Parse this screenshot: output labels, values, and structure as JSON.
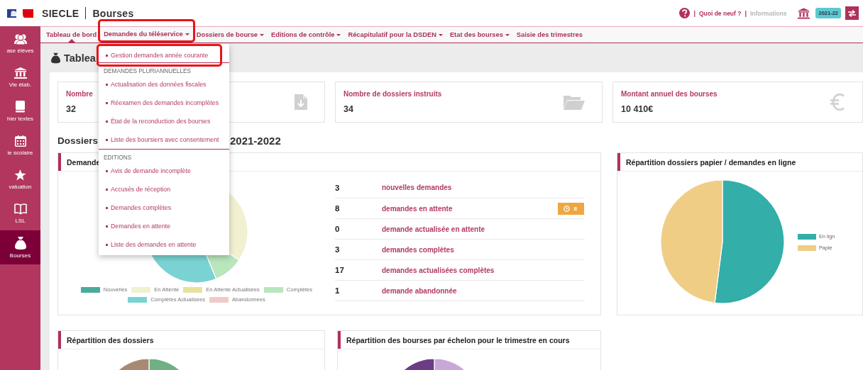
{
  "header": {
    "app": "SIECLE",
    "module": "Bourses",
    "links": [
      {
        "separator": "|",
        "label": "Quoi de neuf ?",
        "disabled": false
      },
      {
        "separator": "|",
        "label": "Informations",
        "disabled": true
      }
    ],
    "year_badge": "2021-22"
  },
  "sidebar": {
    "items": [
      {
        "label": "ase élèves",
        "selected": false
      },
      {
        "label": "Vie étab.",
        "selected": false
      },
      {
        "label": "hier textes",
        "selected": false
      },
      {
        "label": "ie scolaire",
        "selected": false
      },
      {
        "label": "valuation",
        "selected": false
      },
      {
        "label": "LSL",
        "selected": false
      },
      {
        "label": "Bourses",
        "selected": true
      }
    ]
  },
  "nav": {
    "items": [
      {
        "label": "Tableau de bord",
        "selected": true,
        "dropdown": false,
        "highlighted": false
      },
      {
        "label": "Demandes du téléservice",
        "selected": false,
        "dropdown": true,
        "highlighted": true
      },
      {
        "label": "Dossiers de bourse",
        "selected": false,
        "dropdown": true,
        "highlighted": false
      },
      {
        "label": "Editions de contrôle",
        "selected": false,
        "dropdown": true,
        "highlighted": false
      },
      {
        "label": "Récapitulatif pour la DSDEN",
        "selected": false,
        "dropdown": true,
        "highlighted": false
      },
      {
        "label": "Etat des bourses",
        "selected": false,
        "dropdown": true,
        "highlighted": false
      },
      {
        "label": "Saisie des trimestres",
        "selected": false,
        "dropdown": false,
        "highlighted": false
      }
    ]
  },
  "menu": {
    "sections": [
      {
        "items": [
          {
            "label": "Gestion demandes année courante",
            "highlighted": true
          }
        ]
      },
      {
        "heading": "DEMANDES PLURIANNUELLES",
        "items": [
          {
            "label": "Actualisation des données fiscales",
            "highlighted": false
          },
          {
            "label": "Réexamen des demandes incomplètes",
            "highlighted": false
          },
          {
            "label": "État de la reconduction des bourses",
            "highlighted": false
          },
          {
            "label": "Liste des boursiers avec consentement",
            "highlighted": false
          }
        ]
      },
      {
        "heading": "EDITIONS",
        "items": [
          {
            "label": "Avis de demande incomplète",
            "highlighted": false
          },
          {
            "label": "Accusés de réception",
            "highlighted": false
          },
          {
            "label": "Demandes complètes",
            "highlighted": false
          },
          {
            "label": "Demandes en attente",
            "highlighted": false
          },
          {
            "label": "Liste des demandes en attente",
            "highlighted": false
          }
        ]
      }
    ]
  },
  "page": {
    "title": "Tablea"
  },
  "stats": [
    {
      "label": "Nombre",
      "value": "32"
    },
    {
      "label": "Nombre de dossiers instruits",
      "value": "34"
    },
    {
      "label": "Montant annuel des bourses",
      "value": "10 410€"
    }
  ],
  "section_title": {
    "left": "Dossiers",
    "right": "2021-2022"
  },
  "demandes_card": {
    "title": "Demande",
    "legend": [
      {
        "label": "Nouvelles",
        "color": "#4aab9c"
      },
      {
        "label": "En Attente",
        "color": "#f1f0d0"
      },
      {
        "label": "En Attente Actualisées",
        "color": "#e6e29e"
      },
      {
        "label": "Complètes",
        "color": "#b9e6bd"
      },
      {
        "label": "Complètes Actualisées",
        "color": "#7ad3d2"
      },
      {
        "label": "Abandonnées",
        "color": "#f0c9c9"
      }
    ],
    "rows": [
      {
        "count": "3",
        "label": "nouvelles demandes"
      },
      {
        "count": "8",
        "label": "demandes en attente",
        "badge": "8"
      },
      {
        "count": "0",
        "label": "demande actualisée en attente"
      },
      {
        "count": "3",
        "label": "demandes complètes"
      },
      {
        "count": "17",
        "label": "demandes actualisées complètes"
      },
      {
        "count": "1",
        "label": "demande abandonnée"
      }
    ]
  },
  "online_card": {
    "title": "Répartition dossiers papier / demandes en ligne",
    "legend": [
      {
        "label": "En lign",
        "color": "#33aea8"
      },
      {
        "label": "Papie",
        "color": "#efcd85"
      }
    ]
  },
  "bottom_cards": [
    {
      "title": "Répartition des dossiers"
    },
    {
      "title": "Répartition des bourses par échelon pour le trimestre en cours"
    }
  ]
}
